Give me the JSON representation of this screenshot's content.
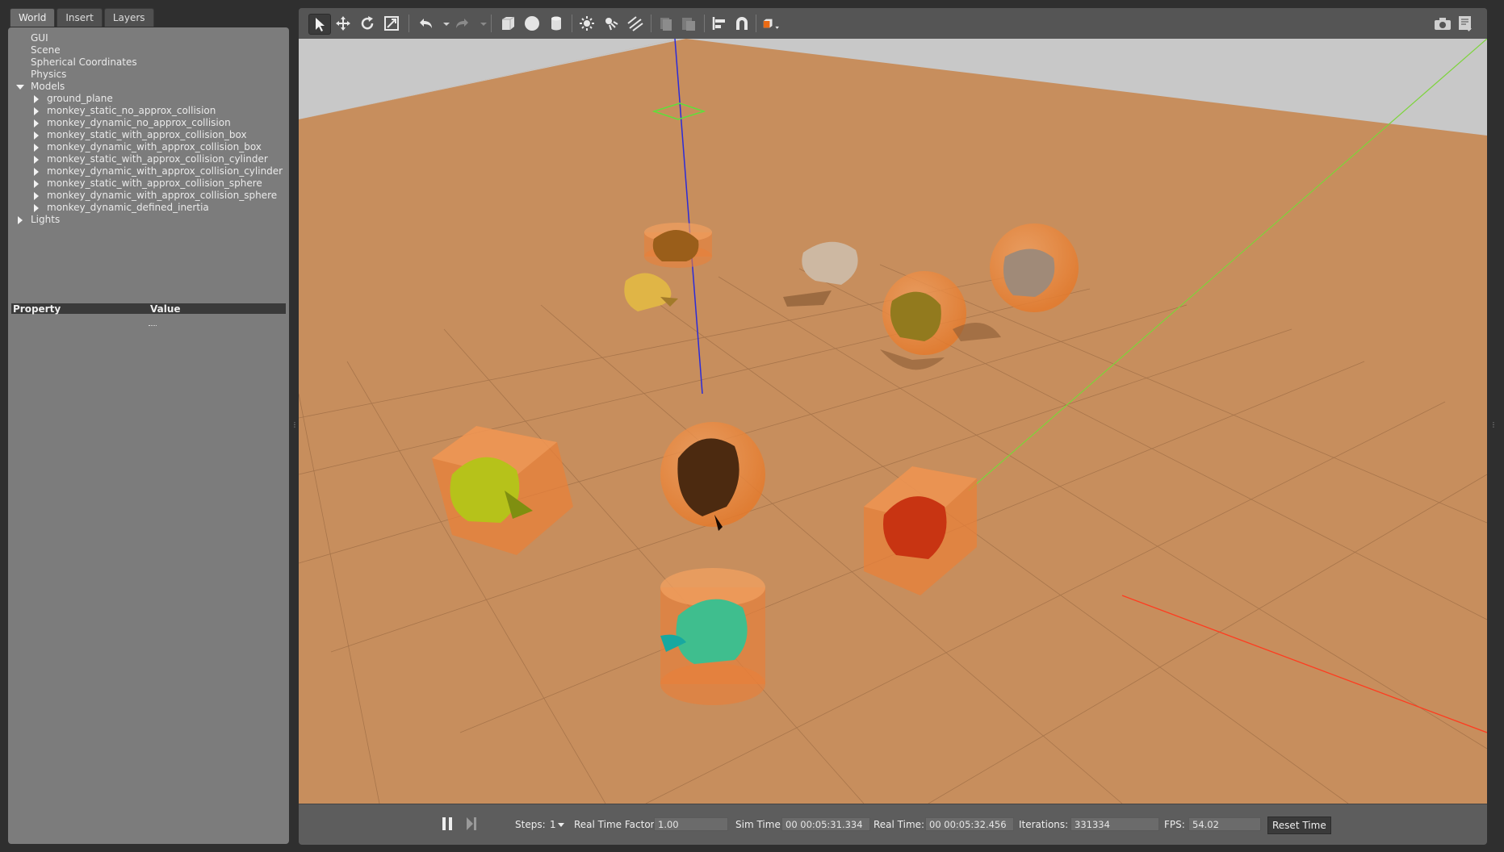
{
  "tabs": [
    "World",
    "Insert",
    "Layers"
  ],
  "tree": {
    "items": [
      {
        "label": "GUI",
        "level": 0,
        "expander": "none"
      },
      {
        "label": "Scene",
        "level": 0,
        "expander": "none"
      },
      {
        "label": "Spherical Coordinates",
        "level": 0,
        "expander": "none"
      },
      {
        "label": "Physics",
        "level": 0,
        "expander": "none"
      },
      {
        "label": "Models",
        "level": 0,
        "expander": "expanded"
      },
      {
        "label": "ground_plane",
        "level": 1,
        "expander": "collapsed"
      },
      {
        "label": "monkey_static_no_approx_collision",
        "level": 1,
        "expander": "collapsed"
      },
      {
        "label": "monkey_dynamic_no_approx_collision",
        "level": 1,
        "expander": "collapsed"
      },
      {
        "label": "monkey_static_with_approx_collision_box",
        "level": 1,
        "expander": "collapsed"
      },
      {
        "label": "monkey_dynamic_with_approx_collision_box",
        "level": 1,
        "expander": "collapsed"
      },
      {
        "label": "monkey_static_with_approx_collision_cylinder",
        "level": 1,
        "expander": "collapsed"
      },
      {
        "label": "monkey_dynamic_with_approx_collision_cylinder",
        "level": 1,
        "expander": "collapsed"
      },
      {
        "label": "monkey_static_with_approx_collision_sphere",
        "level": 1,
        "expander": "collapsed"
      },
      {
        "label": "monkey_dynamic_with_approx_collision_sphere",
        "level": 1,
        "expander": "collapsed"
      },
      {
        "label": "monkey_dynamic_defined_inertia",
        "level": 1,
        "expander": "collapsed"
      },
      {
        "label": "Lights",
        "level": 0,
        "expander": "collapsed"
      }
    ]
  },
  "properties": {
    "col_property": "Property",
    "col_value": "Value"
  },
  "toolbar": {
    "icons": [
      "select-arrow-icon",
      "translate-icon",
      "rotate-icon",
      "scale-icon",
      "undo-icon",
      "undo-dropdown-icon",
      "redo-icon",
      "redo-dropdown-icon",
      "box-shape-icon",
      "sphere-shape-icon",
      "cylinder-shape-icon",
      "point-light-icon",
      "spot-light-icon",
      "directional-light-icon",
      "copy-icon",
      "paste-icon",
      "align-icon",
      "snap-magnet-icon",
      "view-angle-icon",
      "screenshot-icon",
      "log-icon"
    ]
  },
  "bottom": {
    "steps_label": "Steps:",
    "steps_value": "1",
    "rtf_label": "Real Time Factor:",
    "rtf_value": "1.00",
    "sim_label": "Sim Time:",
    "sim_value": "00 00:05:31.334",
    "real_label": "Real Time:",
    "real_value": "00 00:05:32.456",
    "iter_label": "Iterations:",
    "iter_value": "331334",
    "fps_label": "FPS:",
    "fps_value": "54.02",
    "reset_label": "Reset Time"
  },
  "colors": {
    "ground": "#c78e5d",
    "sky": "#c8c8c8",
    "collision": "#e8803a",
    "axis_x": "#ff3b1f",
    "axis_y": "#7cd43a",
    "axis_z": "#2b2bd8"
  }
}
